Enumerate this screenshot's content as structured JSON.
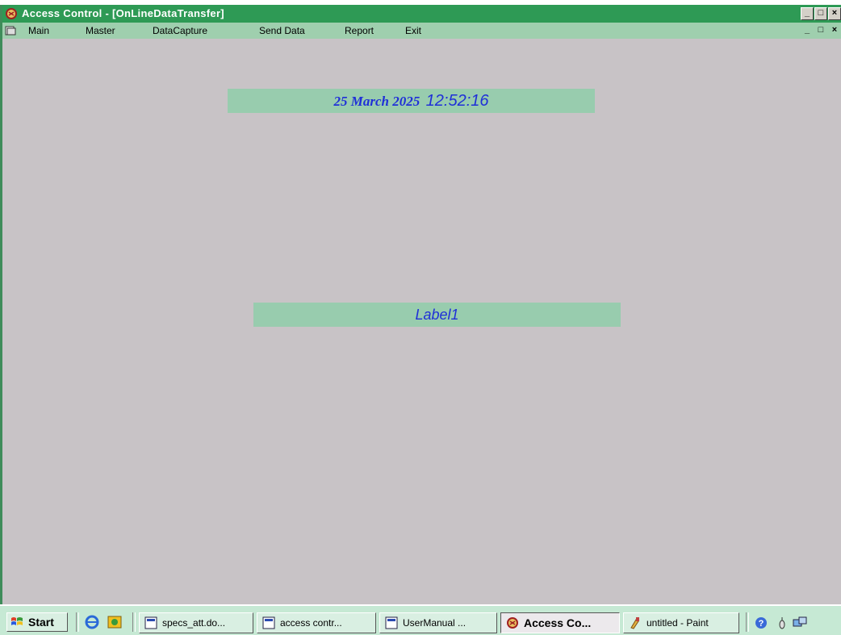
{
  "window": {
    "title": "Access Control - [OnLineDataTransfer]",
    "controls": {
      "minimize": "_",
      "restore": "□",
      "close": "×"
    }
  },
  "menubar": {
    "items": [
      "Main",
      "Master",
      "DataCapture",
      "Send Data",
      "Report",
      "Exit"
    ]
  },
  "main": {
    "date_text": "25 March 2025",
    "time_text": "12:52:16",
    "label_text": "Label1"
  },
  "taskbar": {
    "start_label": "Start",
    "buttons": [
      {
        "label": "specs_att.do..."
      },
      {
        "label": "access contr..."
      },
      {
        "label": "UserManual ..."
      },
      {
        "label": "Access Co..."
      },
      {
        "label": "untitled - Paint"
      }
    ]
  },
  "colors": {
    "titlebar": "#2e9a55",
    "menubar": "#9fcfae",
    "workspace": "#c8c3c6",
    "panel": "#98ccae",
    "panel_text": "#1f2fd8",
    "taskbar": "#c6e9d4"
  }
}
